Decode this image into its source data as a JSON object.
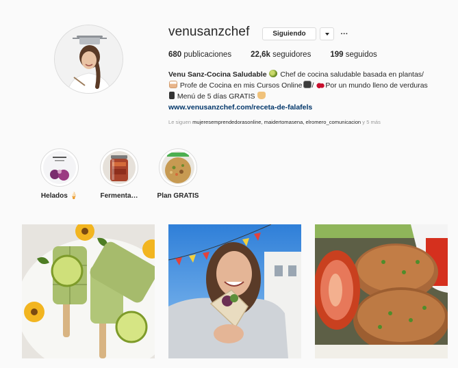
{
  "profile": {
    "username": "venusanzchef",
    "follow_label": "Siguiendo",
    "stats": {
      "posts_count": "680",
      "posts_label": "publicaciones",
      "followers_count": "22,6k",
      "followers_label": "seguidores",
      "following_count": "199",
      "following_label": "seguidos"
    },
    "bio": {
      "name": "Venu Sanz-Cocina Saludable",
      "line1": "Chef de cocina saludable basada en plantas/",
      "line2a": "Profe de Cocina en mis Cursos Online",
      "line2b": "/",
      "line2c": "Por un mundo lleno de verduras",
      "line3": "Menú de 5 días GRATIS",
      "link": "www.venusanzchef.com/receta-de-falafels"
    },
    "followed_by": {
      "prefix": "Le siguen",
      "accounts": "mujeresemprendedorasonline, maidertomasena, elromero_comunicacion",
      "suffix": "y 5 más"
    }
  },
  "highlights": [
    {
      "label": "Helados 🍦",
      "icon": "ice-cream-photo"
    },
    {
      "label": "Fermenta…",
      "icon": "fermented-jar-photo"
    },
    {
      "label": "Plan GRATIS",
      "icon": "food-bowl-photo"
    }
  ],
  "posts": [
    {
      "icon": "green-popsicles-photo"
    },
    {
      "icon": "woman-eating-wrap-photo"
    },
    {
      "icon": "veggie-burgers-photo"
    }
  ],
  "colors": {
    "background": "#fafafa",
    "border": "#dbdbdb",
    "link": "#003569",
    "muted": "#999999"
  }
}
